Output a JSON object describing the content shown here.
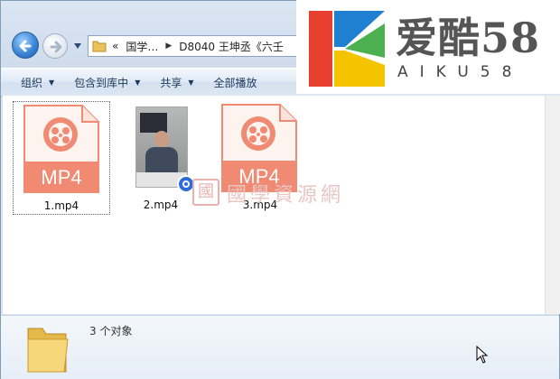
{
  "address": {
    "overflow": "«",
    "segments": [
      "国学…",
      "D8040 王坤丞《六壬"
    ]
  },
  "toolbar": {
    "items": [
      {
        "label": "组织",
        "has_menu": true
      },
      {
        "label": "包含到库中",
        "has_menu": true
      },
      {
        "label": "共享",
        "has_menu": true
      },
      {
        "label": "全部播放",
        "has_menu": false
      }
    ]
  },
  "files": [
    {
      "name": "1.mp4",
      "icon": "mp4-file-icon",
      "badge": "MP4",
      "selected": true
    },
    {
      "name": "2.mp4",
      "icon": "video-thumbnail",
      "badge": "",
      "selected": false
    },
    {
      "name": "3.mp4",
      "icon": "mp4-file-icon",
      "badge": "MP4",
      "selected": false
    }
  ],
  "watermark": {
    "seal": "國",
    "text": "國學資源網"
  },
  "details": {
    "item_count": "3 个对象"
  },
  "logo": {
    "title": "爱酷58",
    "subtitle": "AIKU58"
  },
  "colors": {
    "mp4_accent": "#f08a72",
    "selection_border": "#666666"
  }
}
